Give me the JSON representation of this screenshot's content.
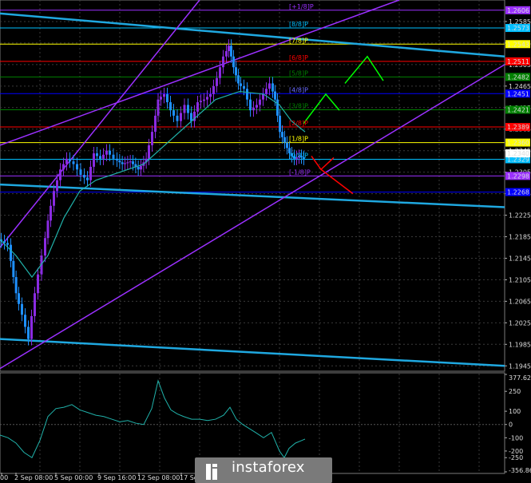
{
  "chart_data": {
    "type": "candlestick",
    "price_axis": {
      "ticks": [
        "1.2585",
        "1.2545",
        "1.2505",
        "1.2465",
        "1.2425",
        "1.2385",
        "1.2345",
        "1.2305",
        "1.2265",
        "1.2225",
        "1.2185",
        "1.2145",
        "1.2105",
        "1.2065",
        "1.2025",
        "1.1985",
        "1.1945"
      ],
      "ylim": [
        1.1935,
        1.2625
      ]
    },
    "time_axis": {
      "ticks": [
        "00",
        "2 Sep 08:00",
        "5 Sep 00:00",
        "9 Sep 16:00",
        "12 Sep 08:00",
        "17 Se"
      ]
    },
    "murrey_levels": [
      {
        "label": "[+1/8]P",
        "value": 1.2606,
        "box": "1.2606",
        "color": "#9b30ff"
      },
      {
        "label": "[8/8]P",
        "value": 1.2573,
        "box": "1.2573",
        "color": "#00bfff"
      },
      {
        "label": "[7/8]P",
        "value": 1.2543,
        "box": "1.2543",
        "color": "#ffff00"
      },
      {
        "label": "[6/8]P",
        "value": 1.2511,
        "box": "1.2511",
        "color": "#ff0000"
      },
      {
        "label": "[5/8]P",
        "value": 1.2482,
        "box": "1.2482",
        "color": "#008000"
      },
      {
        "label": "[4/8]P",
        "value": 1.2451,
        "box": "1.2451",
        "color": "#0000ff"
      },
      {
        "label": "[3/8]P",
        "value": 1.2421,
        "box": "1.2421",
        "color": "#008000"
      },
      {
        "label": "[2/8]P",
        "value": 1.2389,
        "box": "1.2389",
        "color": "#ff0000"
      },
      {
        "label": "[1/8]P",
        "value": 1.236,
        "box": "1.2360",
        "color": "#ffff00"
      },
      {
        "label": "[0/8]P",
        "value": 1.2329,
        "box": "1.2329",
        "color": "#00bfff"
      },
      {
        "label": "[-1/8]P",
        "value": 1.2298,
        "box": "1.2298",
        "color": "#9b30ff"
      },
      {
        "label": "",
        "value": 1.2268,
        "box": "1.2268",
        "color": "#0000ff"
      }
    ],
    "current_price": "1.2340",
    "indicator": {
      "ticks": [
        "377.6254",
        "250",
        "100",
        "0",
        "-100",
        "-200",
        "-250",
        "-356.8685"
      ],
      "ylim": [
        -356.8685,
        377.6254
      ]
    },
    "colors": {
      "bull": "#8a2be2",
      "bear": "#1e90ff",
      "ma": "#20b2aa",
      "channel": "#9b30ff",
      "trend": "#1fa8e0",
      "arrow_up": "#00ff00",
      "arrow_down": "#ff0000"
    }
  },
  "branding": {
    "logo_text": "instaforex"
  }
}
